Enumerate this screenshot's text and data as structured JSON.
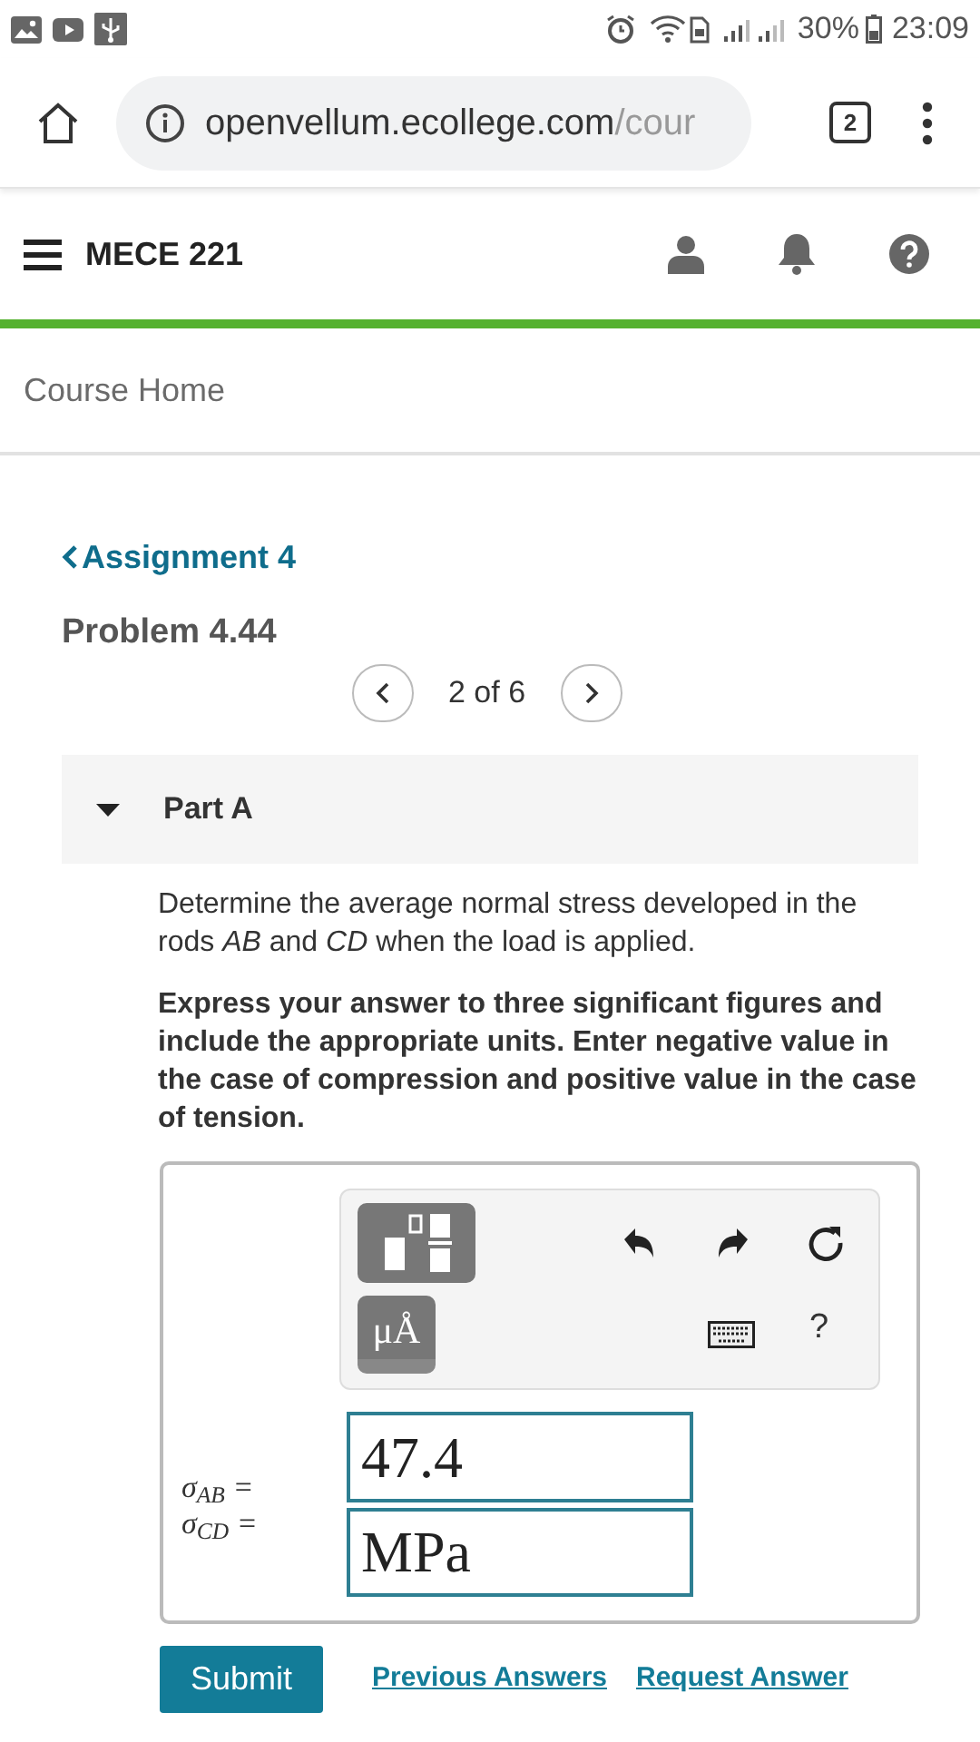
{
  "status_bar": {
    "battery": "30%",
    "time": "23:09"
  },
  "browser": {
    "url_host": "openvellum.ecollege.com",
    "url_path": "/cour",
    "tab_count": "2"
  },
  "header": {
    "course": "MECE 221"
  },
  "breadcrumb": "Course Home",
  "assignment_link": "Assignment 4",
  "problem_title": "Problem 4.44",
  "pager": {
    "position": "2 of 6"
  },
  "part": {
    "title": "Part A",
    "expanded": true
  },
  "question": "Determine the average normal stress developed in the rods *AB* and *CD* when the load is applied.",
  "instructions": "Express your answer to three significant figures and include the appropriate units. Enter negative value in the case of compression and positive value in the case of tension.",
  "answer": {
    "units_button": "μÅ",
    "help": "?",
    "labels": [
      "σ$_{AB}$ =",
      "σ$_{CD}$ ="
    ],
    "value": "47.4",
    "unit": "MPa"
  },
  "actions": {
    "submit": "Submit",
    "links": [
      "Previous Answers",
      "Request Answer"
    ]
  }
}
